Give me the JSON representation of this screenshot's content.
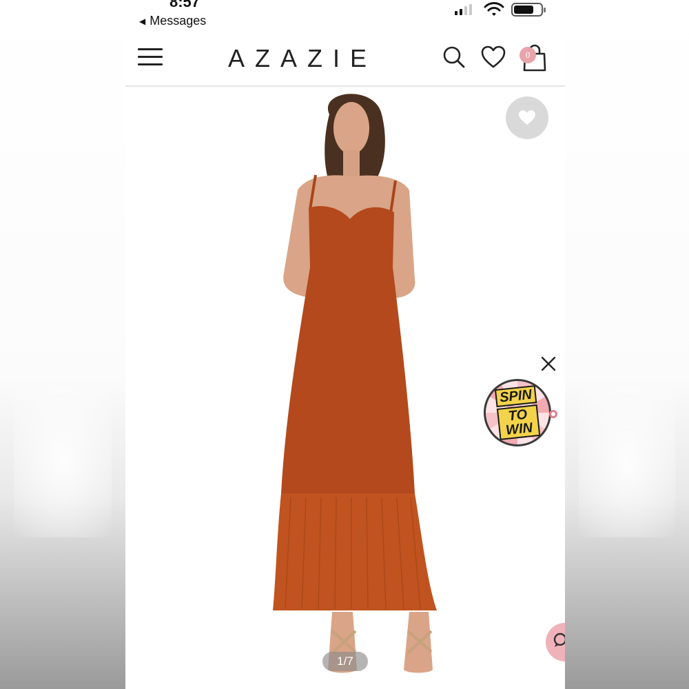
{
  "status_bar": {
    "time": "8:57",
    "back_label": "Messages"
  },
  "header": {
    "logo": "AZAZIE",
    "cart_count": "0",
    "icons": [
      "menu-icon",
      "search-icon",
      "heart-icon",
      "shopping-bag-icon"
    ]
  },
  "product": {
    "image_index": "1/7",
    "dress_color": "#b3491c",
    "popup": {
      "spin_line1": "SPIN",
      "spin_line2": "TO WIN"
    }
  },
  "colors": {
    "accent_pink": "#e8a3ab",
    "text_dark": "#222222"
  }
}
